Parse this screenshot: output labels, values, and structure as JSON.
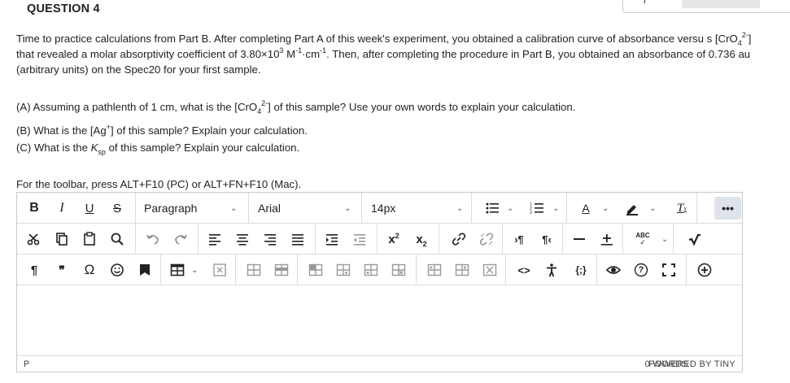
{
  "question": {
    "title": "QUESTION 4"
  },
  "intro": {
    "t1": "Time to practice calculations from Part B. After completing Part A of this week's experiment, you obtained a calibration curve of absorbance versu s [CrO",
    "t1_sub": "4",
    "t1_sup": "2-",
    "t2": "] that revealed a molar absorptivity coefficient of 3.80×10",
    "t2_sup": "3",
    "t3": " M",
    "t3_sup": "-1",
    "t4": "·cm",
    "t4_sup": "-1",
    "t5": ". Then, after completing the procedure in Part B, you obtained an absorbance of 0.736 au (arbitrary units) on the Spec20 for your first sample."
  },
  "qa": {
    "t1": "(A) Assuming a pathlenth of 1 cm, what is the [CrO",
    "sub": "4",
    "sup": "2-",
    "t2": "] of this sample? Use your own words to explain your calculation."
  },
  "qb": {
    "t1": "(B) What is the [Ag",
    "sup": "+",
    "t2": "] of this sample? Explain your calculation."
  },
  "qc": {
    "t1": "(C) What is the ",
    "k": "K",
    "sub": "sp",
    "t2": " of this sample? Explain your calculation."
  },
  "toolbar_note": "For the toolbar, press ALT+F10 (PC) or ALT+FN+F10 (Mac).",
  "toolbar": {
    "bold": "B",
    "italic": "I",
    "underline": "U",
    "strike": "S",
    "format": "Paragraph",
    "font": "Arial",
    "size": "14px",
    "more": "•••",
    "pilcrow": "¶",
    "quote": "❞",
    "omega": "Ω",
    "code": "<>",
    "json": "{;}",
    "help": "?",
    "spell": "ABC",
    "font_color_letter": "A",
    "clear_fmt": "T"
  },
  "statusbar": {
    "path": "P",
    "words": "0 WORDS",
    "powered": "POWERED BY TINY"
  },
  "colors": {
    "border": "#c9c9c9",
    "more_bg": "#dfe3ea",
    "font_color_bar": "#c0392b"
  }
}
